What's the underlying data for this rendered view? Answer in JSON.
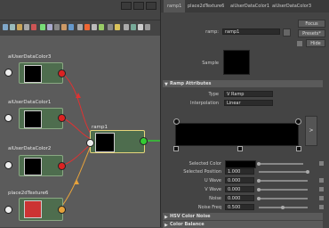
{
  "graph": {
    "nodes": {
      "udc3": {
        "label": "aiUserDataColor3"
      },
      "udc1": {
        "label": "aiUserDataColor1"
      },
      "udc2": {
        "label": "aiUserDataColor2"
      },
      "p2d": {
        "label": "place2dTexture6"
      },
      "ramp": {
        "label": "ramp1"
      }
    }
  },
  "attr_editor": {
    "tabs": [
      "ramp1",
      "place2dTexture6",
      "aiUserDataColor1",
      "aiUserDataColor3"
    ],
    "ramp_label": "ramp:",
    "ramp_name": "ramp1",
    "buttons": {
      "focus": "Focus",
      "presets": "Presets*",
      "hide": "Hide"
    },
    "sample_label": "Sample",
    "section_ramp": "Ramp Attributes",
    "type_label": "Type",
    "type_value": "V Ramp",
    "interp_label": "Interpolation",
    "interp_value": "Linear",
    "selected_color_label": "Selected Color",
    "selected_position_label": "Selected Position",
    "selected_position_value": "1.000",
    "u_wave_label": "U Wave",
    "u_wave_value": "0.000",
    "v_wave_label": "V Wave",
    "v_wave_value": "0.000",
    "noise_label": "Noise",
    "noise_value": "0.000",
    "noise_freq_label": "Noise Freq",
    "noise_freq_value": "0.500",
    "section_hsv": "HSV Color Noise",
    "section_balance": "Color Balance"
  }
}
